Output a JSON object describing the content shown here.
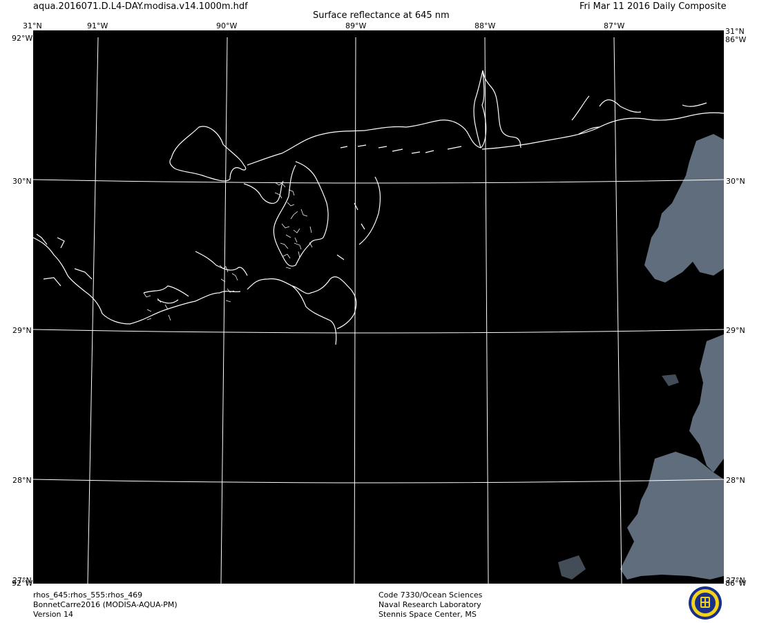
{
  "header": {
    "filename": "aqua.2016071.D.L4-DAY.modisa.v14.1000m.hdf",
    "product_title": "Surface reflectance at 645 nm",
    "date_label": "Fri Mar 11 2016 Daily Composite"
  },
  "map": {
    "lon_labels": [
      "91°W",
      "90°W",
      "89°W",
      "88°W",
      "87°W"
    ],
    "lat_labels": [
      "31°N",
      "30°N",
      "29°N",
      "28°N"
    ],
    "corner_labels": {
      "top_left": "31°N",
      "top_right": "31°N",
      "left_top_w": "92°W",
      "right_top_w": "86°W",
      "bottom_left": "27°N",
      "bottom_right": "27°N",
      "left_bottom_w": "92°W",
      "right_bottom_w": "86°W"
    },
    "colors": {
      "background": "#000000",
      "coastline": "#ffffff",
      "gridlines": "#ffffff",
      "cloud": "#6b7a8c"
    }
  },
  "footer": {
    "left": {
      "line1": "rhos_645:rhos_555:rhos_469",
      "line2": "BonnetCarre2016 (MODISA-AQUA-PM)",
      "line3": "Version 14"
    },
    "center": {
      "line1": "Code 7330/Ocean Sciences",
      "line2": "Naval Research Laboratory",
      "line3": "Stennis Space Center, MS"
    },
    "logo_icon": "navy-seal-icon"
  }
}
